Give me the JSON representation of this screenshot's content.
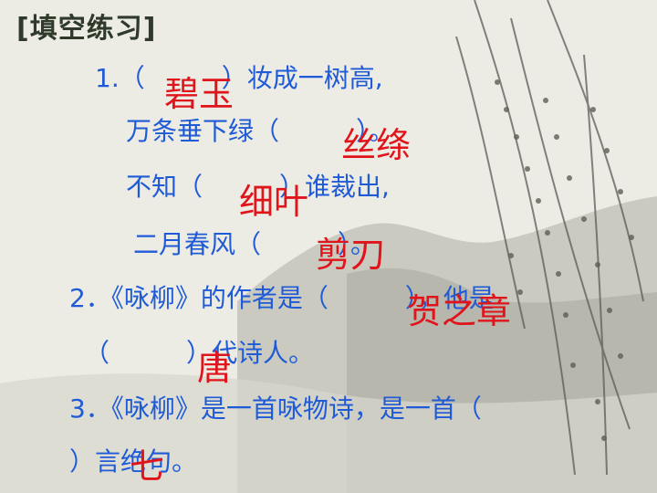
{
  "title": "[填空练习]",
  "lines": [
    "1.（　　　）妆成一树高,",
    "万条垂下绿（　　　）。",
    "不知（　　　）谁裁出,",
    "二月春风（　　　）。",
    "2．《咏柳》的作者是（　　　），他是",
    "（　　　）代诗人。",
    "3．《咏柳》是一首咏物诗，是一首（",
    "）言绝句。"
  ],
  "answers": [
    "碧玉",
    "丝绦",
    "细叶",
    "剪刀",
    "贺之章",
    "唐",
    "七"
  ]
}
